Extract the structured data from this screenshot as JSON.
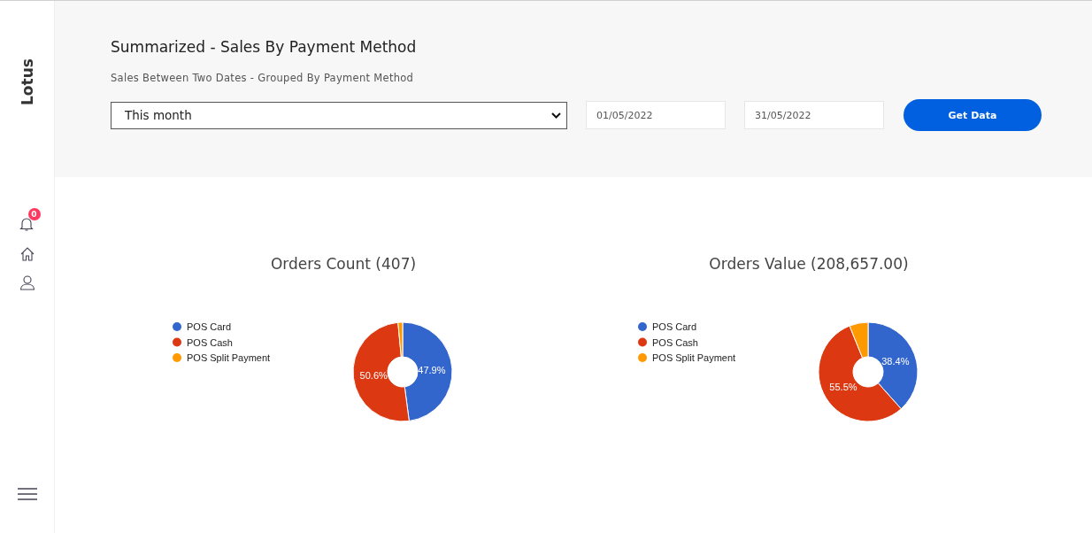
{
  "sidebar": {
    "logo": "Lotus",
    "notification_badge": "0"
  },
  "header": {
    "title": "Summarized - Sales By Payment Method",
    "subtitle": "Sales Between Two Dates - Grouped By Payment Method",
    "period_select": {
      "value": "This month"
    },
    "date_from": {
      "value": "01/05/2022"
    },
    "date_to": {
      "value": "31/05/2022"
    },
    "button": "Get Data"
  },
  "charts": [
    {
      "chart_data": {
        "type": "donut",
        "title": "Orders Count (407)",
        "categories": [
          "POS Card",
          "POS Cash",
          "POS Split Payment"
        ],
        "values": [
          47.9,
          50.6,
          1.5
        ],
        "colors": [
          "#3366cc",
          "#dc3912",
          "#ff9900"
        ],
        "value_labels": [
          "47.9%",
          "50.6%",
          null
        ],
        "legend": "left"
      }
    },
    {
      "chart_data": {
        "type": "donut",
        "title": "Orders Value (208,657.00)",
        "categories": [
          "POS Card",
          "POS Cash",
          "POS Split Payment"
        ],
        "values": [
          38.4,
          55.5,
          6.1
        ],
        "colors": [
          "#3366cc",
          "#dc3912",
          "#ff9900"
        ],
        "value_labels": [
          "38.4%",
          "55.5%",
          null
        ],
        "legend": "left"
      }
    }
  ]
}
